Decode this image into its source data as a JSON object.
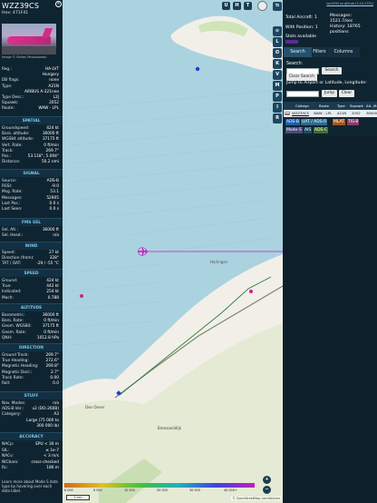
{
  "details": {
    "callsign": "WZZ39CS",
    "hex": "Hex:  471F41",
    "photo_credit": "Image © Stefan Mroszkowski",
    "fields": [
      {
        "k": "Reg.:",
        "v": "HA-LVT"
      },
      {
        "k": "",
        "v": "Hungary"
      },
      {
        "k": "DB flags:",
        "v": "none"
      },
      {
        "k": "Type:",
        "v": "A21N"
      },
      {
        "k": "",
        "v": "AIRBUS A-321neo"
      },
      {
        "k": "Type Desc.:",
        "v": "L2J"
      },
      {
        "k": "Squawk:",
        "v": "2052"
      },
      {
        "k": "Route:",
        "v": "WAW - LPL"
      }
    ],
    "sections": {
      "spatial": "SPATIAL",
      "signal": "SIGNAL",
      "fms": "FMS SEL",
      "wind": "WIND",
      "speed": "SPEED",
      "altitude": "ALTITUDE",
      "direction": "DIRECTION",
      "stuff": "STUFF",
      "accuracy": "ACCURACY"
    },
    "spatial": [
      {
        "k": "Groundspeed:",
        "v": "424 kt"
      },
      {
        "k": "Baro. altitude:",
        "v": "36000 ft"
      },
      {
        "k": "WGS84 altitude:",
        "v": "37175 ft"
      },
      {
        "k": "Vert. Rate:",
        "v": "0 ft/min"
      },
      {
        "k": "Track:",
        "v": "269.7°"
      },
      {
        "k": "Pos.:",
        "v": "53.118°, 5.094°"
      },
      {
        "k": "Distance:",
        "v": "50.2 nmi"
      }
    ],
    "signal": [
      {
        "k": "Source:",
        "v": "ADS-B"
      },
      {
        "k": "RSSI:",
        "v": "-9.0"
      },
      {
        "k": "Msg. Rate:",
        "v": "53.1"
      },
      {
        "k": "Messages:",
        "v": "52905"
      },
      {
        "k": "Last Pos.:",
        "v": "0.0 s"
      },
      {
        "k": "Last Seen:",
        "v": "0.0 s"
      }
    ],
    "fms": [
      {
        "k": "Sel. Alt.:",
        "v": "36000 ft"
      },
      {
        "k": "Sel. Head.:",
        "v": "n/a"
      }
    ],
    "wind": [
      {
        "k": "Speed:",
        "v": "27 kt"
      },
      {
        "k": "Direction (from):",
        "v": "328°"
      },
      {
        "k": "TAT / OAT:",
        "v": "-29 / -55 °C"
      }
    ],
    "speed": [
      {
        "k": "Ground:",
        "v": "424 kt"
      },
      {
        "k": "True:",
        "v": "442 kt"
      },
      {
        "k": "Indicated:",
        "v": "254 kt"
      },
      {
        "k": "Mach:",
        "v": "0.788"
      }
    ],
    "altitude": [
      {
        "k": "Barometric:",
        "v": "36000 ft"
      },
      {
        "k": "Baro. Rate:",
        "v": "0 ft/min"
      },
      {
        "k": "Geom. WGS84:",
        "v": "37175 ft"
      },
      {
        "k": "Geom. Rate:",
        "v": "0 ft/min"
      },
      {
        "k": "QNH:",
        "v": "1012.8 hPa"
      }
    ],
    "direction": [
      {
        "k": "Ground Track:",
        "v": "269.7°"
      },
      {
        "k": "True Heading:",
        "v": "272.6°"
      },
      {
        "k": "Magnetic Heading:",
        "v": "269.8°"
      },
      {
        "k": "Magnetic Decl.:",
        "v": "2.7°"
      },
      {
        "k": "Track Rate:",
        "v": "0.00"
      },
      {
        "k": "Roll:",
        "v": "0.0"
      }
    ],
    "stuff": [
      {
        "k": "Nav. Modes:",
        "v": "n/a"
      },
      {
        "k": "ADS-B Ver.:",
        "v": "v2 (DO-260B)"
      },
      {
        "k": "Category:",
        "v": "A3"
      },
      {
        "k": "",
        "v": "Large (75 000 to"
      },
      {
        "k": "",
        "v": "300 000 lb)"
      }
    ],
    "accuracy": [
      {
        "k": "NACp:",
        "v": "EPU < 30 m"
      },
      {
        "k": "SIL:",
        "v": "≤ 1e-7"
      },
      {
        "k": "NACv:",
        "v": "< 3 m/s"
      },
      {
        "k": "NICbaro:",
        "v": "cross-checked"
      },
      {
        "k": "Rc:",
        "v": "186 m"
      }
    ],
    "note": "Learn more about Mode S data type by hovering over each data label."
  },
  "map": {
    "top_buttons": [
      "U",
      "H",
      "T"
    ],
    "left_buttons": [
      "⊙",
      "L",
      "O",
      "K",
      "V",
      "M",
      "P",
      "I",
      "R"
    ],
    "zoom_in": "+",
    "zoom_out": "−",
    "scale": "5 nm",
    "attribution": "© OpenStreetMap contributors",
    "color_ticks": [
      "6 000",
      "8 000",
      "10 000",
      "20 000",
      "30 000",
      "40 000+"
    ],
    "place_labels": [
      "Harlingen",
      "Breezanddijk",
      "Den Oever"
    ],
    "colors": {
      "sea": "#aad3df",
      "land": "#f2efe9",
      "track": "#2f7d3a",
      "aircraft": "#c21ac2"
    }
  },
  "sidebar": {
    "source_link": "tar1090 on github (3.14.1751)",
    "total_aircraft": "Total Aircraft: 1",
    "with_position": "With Position: 1",
    "messages": "Messages: 1521.7/sec",
    "history": "History: 18765 positions",
    "stats": "Stats available",
    "tabs": [
      "Search",
      "Filters",
      "Columns"
    ],
    "search_label": "Search:",
    "search_btn": "Search",
    "clear_btn": "Clear Search",
    "jump_label": "Jump to Airport or Latitude, Longitude:",
    "jump_btn": "Jump",
    "clear2_btn": "Clear",
    "columns": [
      "Callsign",
      "Route",
      "Type",
      "Squawk",
      "Alt. (ft)"
    ],
    "rows": [
      {
        "callsign": "WZZ39CS",
        "route": "WAW - LPL",
        "type": "A21N",
        "squawk": "2052",
        "alt": "36000"
      }
    ],
    "legend": [
      {
        "label": "ADS-B",
        "color": "#1a5fb4"
      },
      {
        "label": "UAT / ADS-R",
        "color": "#2a6d93"
      },
      {
        "label": "MLAT",
        "color": "#a8561f"
      },
      {
        "label": "TIS-B",
        "color": "#8a3d6b"
      },
      {
        "label": "Mode-S",
        "color": "#4a4a7a"
      },
      {
        "label": "AIS",
        "color": "#1c4a62"
      },
      {
        "label": "ADS-C",
        "color": "#3f6e2c"
      }
    ]
  }
}
